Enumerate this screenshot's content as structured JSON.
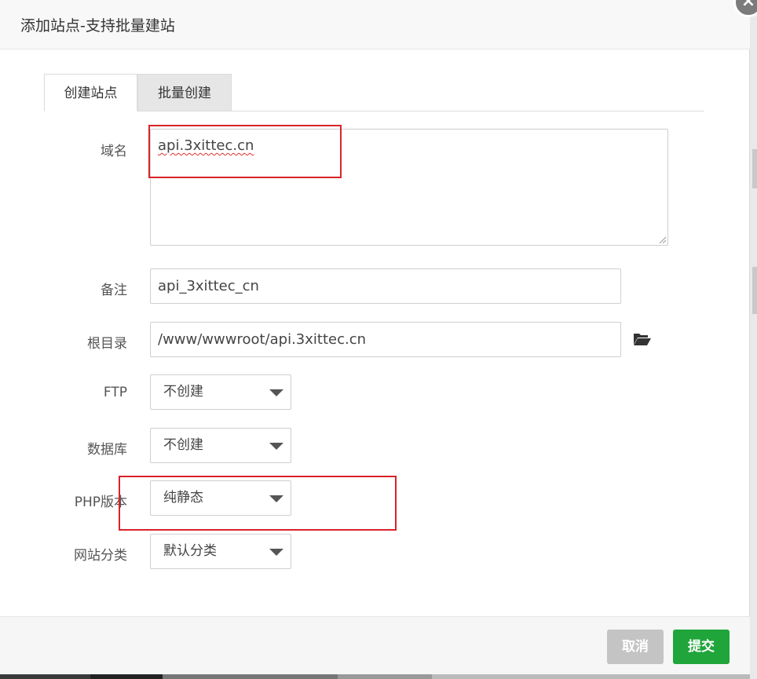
{
  "dialog": {
    "title": "添加站点-支持批量建站",
    "close_icon": "close-icon"
  },
  "tabs": [
    {
      "label": "创建站点",
      "active": true
    },
    {
      "label": "批量创建",
      "active": false
    }
  ],
  "form": {
    "domain": {
      "label": "域名",
      "value": "api.3xittec.cn"
    },
    "remark": {
      "label": "备注",
      "value": "api_3xittec_cn"
    },
    "root_dir": {
      "label": "根目录",
      "value": "/www/wwwroot/api.3xittec.cn",
      "icon": "folder-open-icon"
    },
    "ftp": {
      "label": "FTP",
      "selected": "不创建"
    },
    "database": {
      "label": "数据库",
      "selected": "不创建"
    },
    "php_version": {
      "label": "PHP版本",
      "selected": "纯静态"
    },
    "site_category": {
      "label": "网站分类",
      "selected": "默认分类"
    }
  },
  "footer": {
    "cancel_label": "取消",
    "submit_label": "提交"
  },
  "colors": {
    "accent": "#20a53a",
    "highlight": "#d9232a",
    "cancel_bg": "#c4c4c4"
  }
}
